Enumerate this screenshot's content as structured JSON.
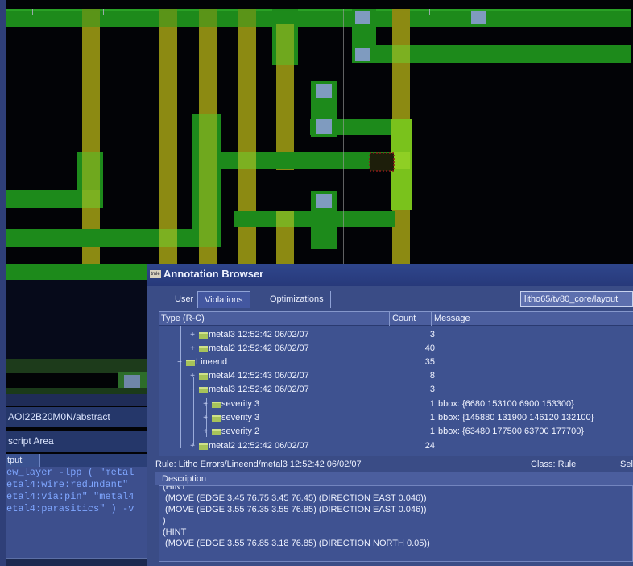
{
  "colors": {
    "background": "#020306",
    "metal_green": "#1d8a1b",
    "poly_olive": "#8c8a12",
    "via_blue": "#7f9bbf",
    "overlay_blue": "#2d4386"
  },
  "left_panel": {
    "cell_name": "AOI22B20M0N/abstract",
    "script_area_label": "script Area",
    "output_tab_label": "tput",
    "output_lines": [
      "ew_layer -lpp ( \"metal",
      "etal4:wire:redundant\"",
      "etal4:via:pin\" \"metal4",
      "etal4:parasitics\" ) -v"
    ]
  },
  "annotation_browser": {
    "app_icon_text": "tmle",
    "title": "Annotation Browser",
    "tabs": [
      "User",
      "Violations",
      "Optimizations"
    ],
    "active_tab": "Violations",
    "path_field": "litho65/tv80_core/layout",
    "columns": [
      "Type (R-C)",
      "Count",
      "Message"
    ],
    "rows": [
      {
        "expander": "+",
        "label": "metal3 12:52:42 06/02/07",
        "count": "3",
        "message": ""
      },
      {
        "expander": "+",
        "label": "metal2 12:52:42 06/02/07",
        "count": "40",
        "message": ""
      },
      {
        "expander": "−",
        "label": "Lineend",
        "count": "35",
        "message": ""
      },
      {
        "expander": "+",
        "label": "metal4 12:52:43 06/02/07",
        "count": "8",
        "message": ""
      },
      {
        "expander": "−",
        "label": "metal3 12:52:42 06/02/07",
        "count": "3",
        "message": ""
      },
      {
        "expander": "+",
        "label": "severity  3",
        "count": "1",
        "message": "bbox: {6680 153100 6900 153300}"
      },
      {
        "expander": "+",
        "label": "severity  3",
        "count": "1",
        "message": "bbox: {145880 131900 146120 132100}"
      },
      {
        "expander": "+",
        "label": "severity  2",
        "count": "1",
        "message": "bbox: {63480 177500 63700 177700}"
      },
      {
        "expander": "+",
        "label": "metal2 12:52:42 06/02/07",
        "count": "24",
        "message": ""
      }
    ],
    "rule_text": "Rule: Litho Errors/Lineend/metal3 12:52:42 06/02/07",
    "class_text": "Class: Rule",
    "sel_text": "Sel",
    "description_label": "Description",
    "description_lines": [
      "(HINT",
      " (MOVE (EDGE 3.45 76.75 3.45 76.45) (DIRECTION EAST 0.046))",
      " (MOVE (EDGE 3.55 76.35 3.55 76.85) (DIRECTION EAST 0.046))",
      ")",
      "(HINT",
      " (MOVE (EDGE 3.55 76.85 3.18 76.85) (DIRECTION NORTH 0.05))"
    ]
  }
}
